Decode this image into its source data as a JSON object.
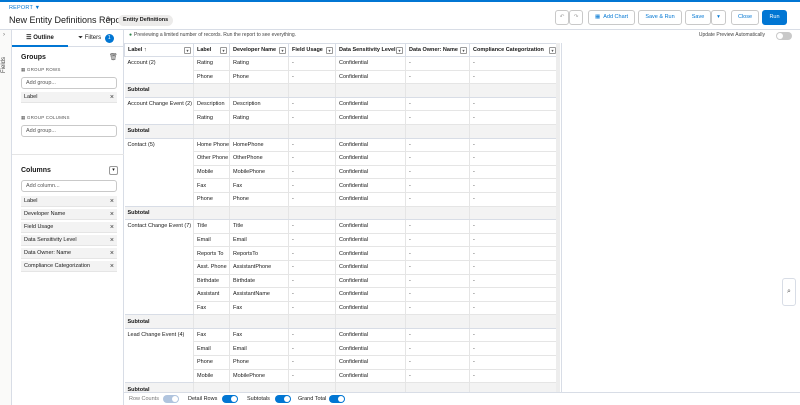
{
  "header": {
    "crumb": "REPORT ▼",
    "title": "New Entity Definitions Report",
    "badge": "Entity Definitions",
    "add_chart": "Add Chart",
    "save_run": "Save & Run",
    "save": "Save",
    "close": "Close",
    "run": "Run"
  },
  "rail": {
    "label": "Fields"
  },
  "panel": {
    "tab_outline": "Outline",
    "tab_filters": "Filters",
    "filter_count": "1",
    "groups_title": "Groups",
    "group_rows": "GROUP ROWS",
    "add_group_placeholder": "Add group...",
    "group_row_items": [
      "Label"
    ],
    "group_columns": "GROUP COLUMNS",
    "columns_title": "Columns",
    "add_column_placeholder": "Add column...",
    "columns": [
      "Label",
      "Developer Name",
      "Field Usage",
      "Data Sensitivity Level",
      "Data Owner: Name",
      "Compliance Categorization"
    ]
  },
  "preview": {
    "notice": "Previewing a limited number of records. Run the report to see everything.",
    "auto_update": "Update Preview Automatically"
  },
  "table": {
    "headers": [
      "Label ↑",
      "Label",
      "Developer Name",
      "Field Usage",
      "Data Sensitivity Level",
      "Data Owner: Name",
      "Compliance Categorization"
    ],
    "groups": [
      {
        "name": "Account (2)",
        "rows": [
          [
            "Rating",
            "Rating"
          ],
          [
            "Phone",
            "Phone"
          ]
        ]
      },
      {
        "name": "Account Change Event (2)",
        "rows": [
          [
            "Description",
            "Description"
          ],
          [
            "Rating",
            "Rating"
          ]
        ]
      },
      {
        "name": "Contact (5)",
        "rows": [
          [
            "Home Phone",
            "HomePhone"
          ],
          [
            "Other Phone",
            "OtherPhone"
          ],
          [
            "Mobile",
            "MobilePhone"
          ],
          [
            "Fax",
            "Fax"
          ],
          [
            "Phone",
            "Phone"
          ]
        ]
      },
      {
        "name": "Contact Change Event (7)",
        "rows": [
          [
            "Title",
            "Title"
          ],
          [
            "Email",
            "Email"
          ],
          [
            "Reports To",
            "ReportsTo"
          ],
          [
            "Asst. Phone",
            "AssistantPhone"
          ],
          [
            "Birthdate",
            "Birthdate"
          ],
          [
            "Assistant",
            "AssistantName"
          ],
          [
            "Fax",
            "Fax"
          ]
        ]
      },
      {
        "name": "Lead Change Event (4)",
        "rows": [
          [
            "Fax",
            "Fax"
          ],
          [
            "Email",
            "Email"
          ],
          [
            "Phone",
            "Phone"
          ],
          [
            "Mobile",
            "MobilePhone"
          ]
        ]
      }
    ],
    "field_usage": "-",
    "sensitivity": "Confidential",
    "owner": "-",
    "compliance": "-",
    "subtotal": "Subtotal"
  },
  "footer": {
    "row_counts": "Row Counts",
    "detail_rows": "Detail Rows",
    "subtotals": "Subtotals",
    "grand_total": "Grand Total"
  }
}
